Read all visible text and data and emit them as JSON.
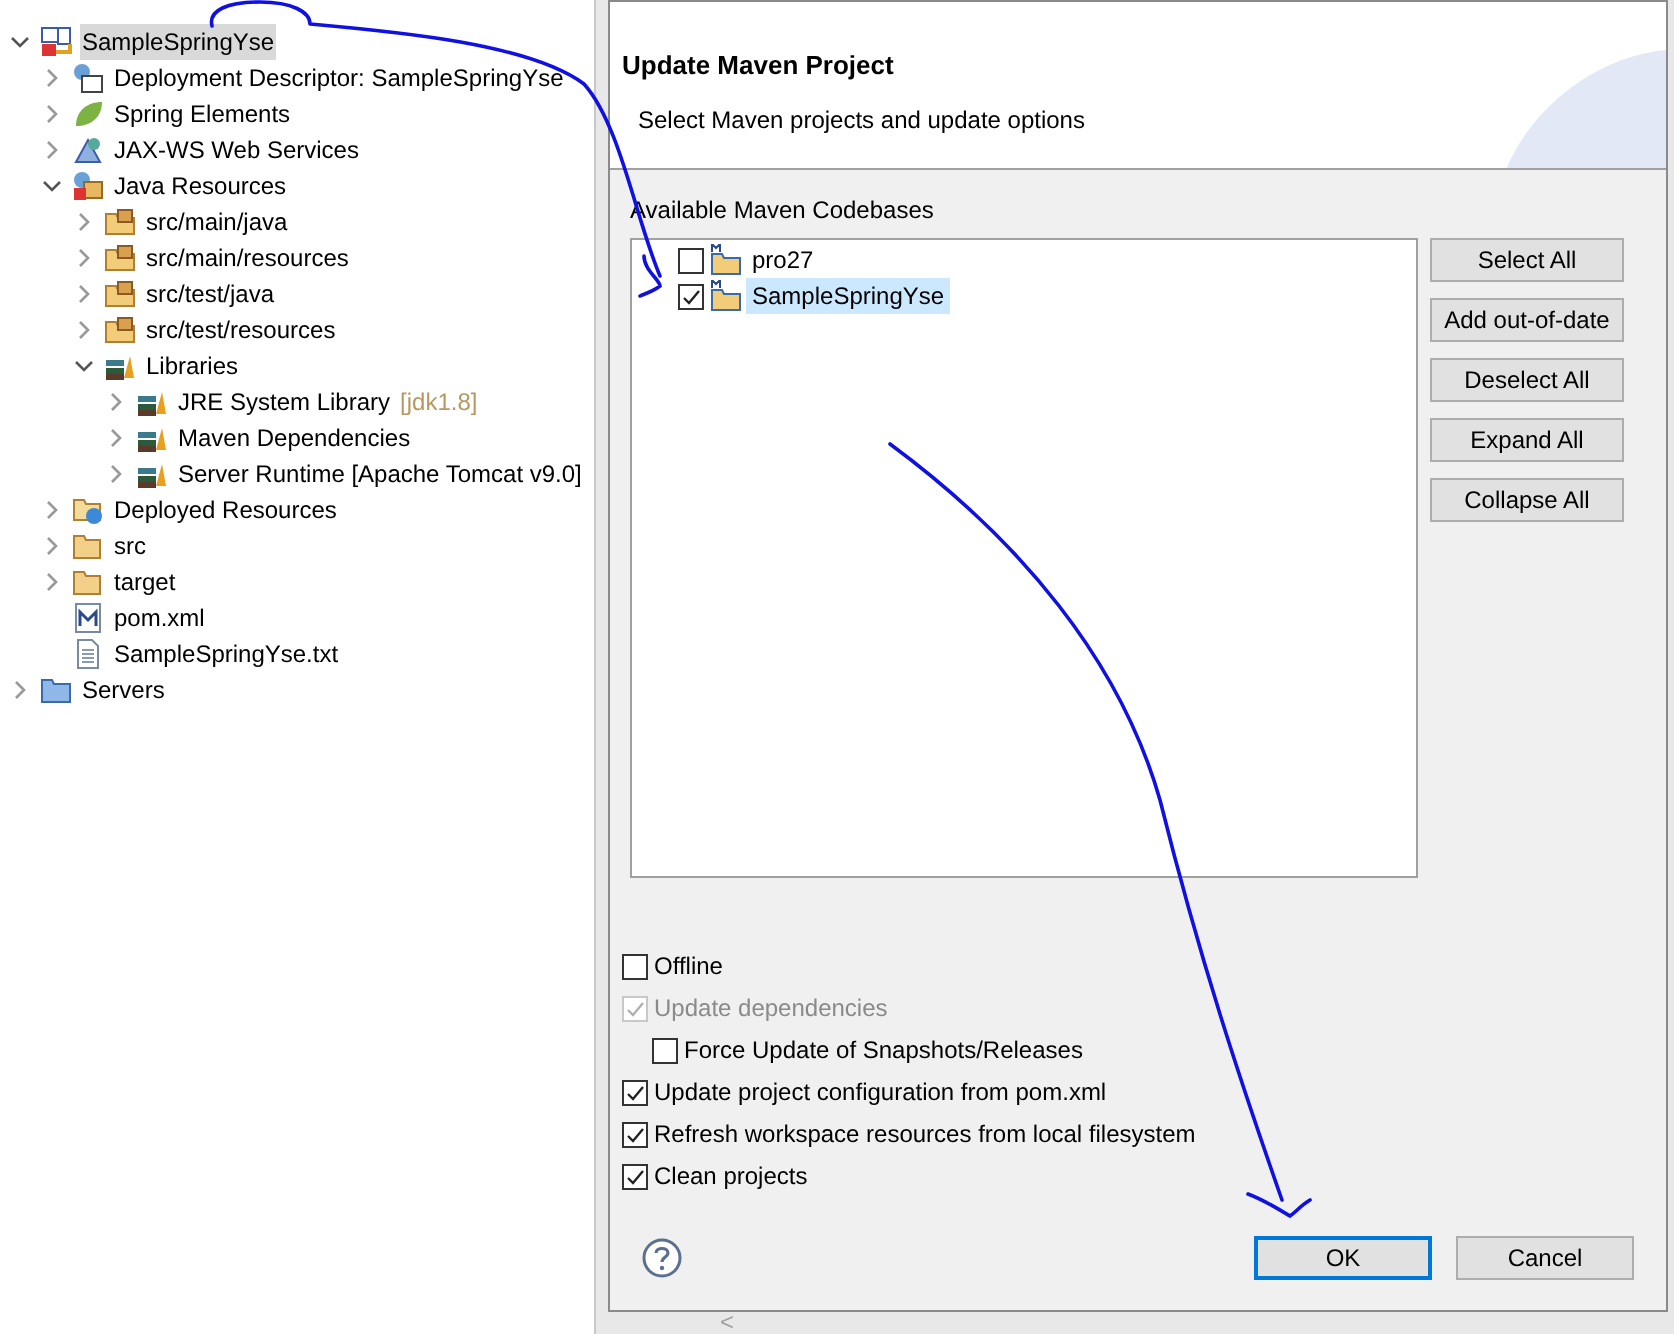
{
  "project_tree": [
    {
      "label": "SampleSpringYse",
      "kind": "project",
      "expanded": true,
      "selected": true,
      "children": [
        {
          "label": "Deployment Descriptor: SampleSpringYse",
          "kind": "descriptor",
          "expanded": false,
          "selected": false
        },
        {
          "label": "Spring Elements",
          "kind": "spring",
          "expanded": false,
          "selected": false
        },
        {
          "label": "JAX-WS Web Services",
          "kind": "webservice",
          "expanded": false,
          "selected": false
        },
        {
          "label": "Java Resources",
          "kind": "javares",
          "expanded": true,
          "selected": false,
          "children": [
            {
              "label": "src/main/java",
              "kind": "package-folder",
              "expanded": false,
              "selected": false
            },
            {
              "label": "src/main/resources",
              "kind": "package-folder",
              "expanded": false,
              "selected": false
            },
            {
              "label": "src/test/java",
              "kind": "package-folder",
              "expanded": false,
              "selected": false
            },
            {
              "label": "src/test/resources",
              "kind": "package-folder",
              "expanded": false,
              "selected": false
            },
            {
              "label": "Libraries",
              "kind": "library",
              "expanded": true,
              "selected": false,
              "children": [
                {
                  "label": "JRE System Library",
                  "suffix": "[jdk1.8]",
                  "kind": "library",
                  "expanded": false,
                  "selected": false
                },
                {
                  "label": "Maven Dependencies",
                  "kind": "library",
                  "expanded": false,
                  "selected": false
                },
                {
                  "label": "Server Runtime [Apache Tomcat v9.0]",
                  "kind": "library",
                  "expanded": false,
                  "selected": false
                }
              ]
            }
          ]
        },
        {
          "label": "Deployed Resources",
          "kind": "deployed",
          "expanded": false,
          "selected": false
        },
        {
          "label": "src",
          "kind": "folder",
          "expanded": false,
          "selected": false
        },
        {
          "label": "target",
          "kind": "folder",
          "expanded": false,
          "selected": false
        },
        {
          "label": "pom.xml",
          "kind": "file-xml",
          "selected": false
        },
        {
          "label": "SampleSpringYse.txt",
          "kind": "file-text",
          "selected": false
        }
      ]
    },
    {
      "label": "Servers",
      "kind": "servers",
      "expanded": false,
      "selected": false
    }
  ],
  "dialog": {
    "heading": "Update Maven Project",
    "subtitle": "Select Maven projects and update options",
    "codebases_label": "Available Maven Codebases",
    "codebases": [
      {
        "label": "pro27",
        "checked": false,
        "selected": false
      },
      {
        "label": "SampleSpringYse",
        "checked": true,
        "selected": true
      }
    ],
    "side_buttons": [
      "Select All",
      "Add out-of-date",
      "Deselect All",
      "Expand All",
      "Collapse All"
    ],
    "options": [
      {
        "label": "Offline",
        "checked": false,
        "disabled": false
      },
      {
        "label": "Update dependencies",
        "checked": true,
        "disabled": true,
        "children": [
          {
            "label": "Force Update of Snapshots/Releases",
            "checked": false,
            "disabled": false
          }
        ]
      },
      {
        "label": "Update project configuration from pom.xml",
        "checked": true,
        "disabled": false
      },
      {
        "label": "Refresh workspace resources from local filesystem",
        "checked": true,
        "disabled": false
      },
      {
        "label": "Clean projects",
        "checked": true,
        "disabled": false
      }
    ],
    "footer_buttons": [
      {
        "label": "OK",
        "default": true
      },
      {
        "label": "Cancel",
        "default": false
      }
    ]
  },
  "scroll_left": "<"
}
